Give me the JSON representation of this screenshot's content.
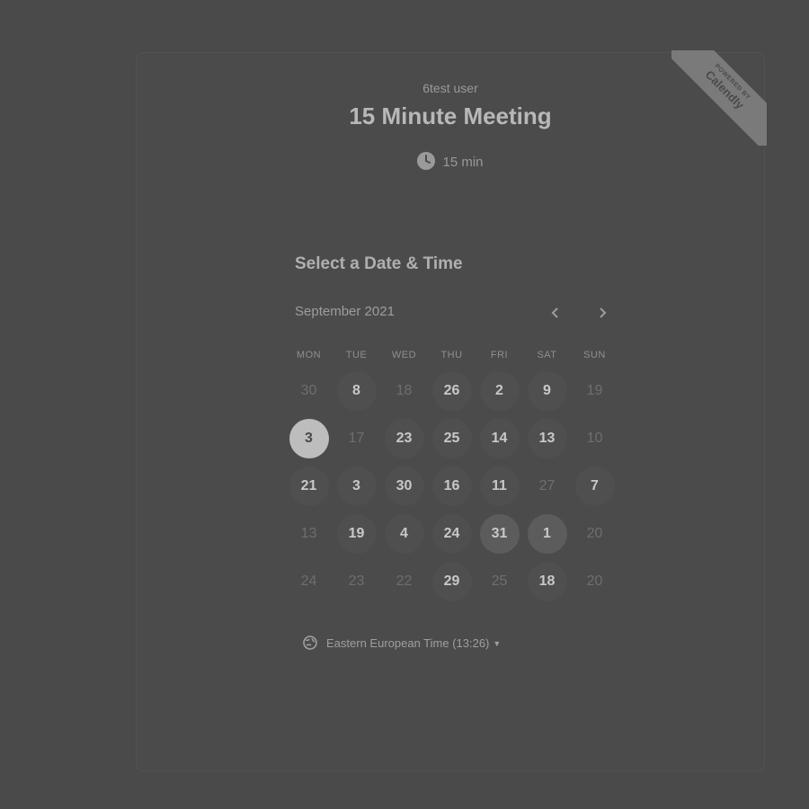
{
  "owner": "6test user",
  "title": "15 Minute Meeting",
  "duration": "15 min",
  "ribbon": {
    "line1": "POWERED BY",
    "line2": "Calendly"
  },
  "heading": "Select a Date & Time",
  "month_label": "September 2021",
  "weekdays": [
    "MON",
    "TUE",
    "WED",
    "THU",
    "FRI",
    "SAT",
    "SUN"
  ],
  "weeks": [
    [
      {
        "n": "30",
        "s": "unavail"
      },
      {
        "n": "8",
        "s": "avail"
      },
      {
        "n": "18",
        "s": "unavail"
      },
      {
        "n": "26",
        "s": "avail"
      },
      {
        "n": "2",
        "s": "avail"
      },
      {
        "n": "9",
        "s": "avail"
      },
      {
        "n": "19",
        "s": "unavail"
      }
    ],
    [
      {
        "n": "3",
        "s": "selected"
      },
      {
        "n": "17",
        "s": "unavail"
      },
      {
        "n": "23",
        "s": "avail"
      },
      {
        "n": "25",
        "s": "avail"
      },
      {
        "n": "14",
        "s": "avail"
      },
      {
        "n": "13",
        "s": "avail"
      },
      {
        "n": "10",
        "s": "unavail"
      }
    ],
    [
      {
        "n": "21",
        "s": "avail"
      },
      {
        "n": "3",
        "s": "avail"
      },
      {
        "n": "30",
        "s": "avail"
      },
      {
        "n": "16",
        "s": "avail"
      },
      {
        "n": "11",
        "s": "avail"
      },
      {
        "n": "27",
        "s": "unavail"
      },
      {
        "n": "7",
        "s": "avail"
      }
    ],
    [
      {
        "n": "13",
        "s": "unavail"
      },
      {
        "n": "19",
        "s": "avail"
      },
      {
        "n": "4",
        "s": "avail"
      },
      {
        "n": "24",
        "s": "avail"
      },
      {
        "n": "31",
        "s": "highlight"
      },
      {
        "n": "1",
        "s": "highlight"
      },
      {
        "n": "20",
        "s": "unavail"
      }
    ],
    [
      {
        "n": "24",
        "s": "unavail"
      },
      {
        "n": "23",
        "s": "unavail"
      },
      {
        "n": "22",
        "s": "unavail"
      },
      {
        "n": "29",
        "s": "avail"
      },
      {
        "n": "25",
        "s": "unavail"
      },
      {
        "n": "18",
        "s": "avail"
      },
      {
        "n": "20",
        "s": "unavail"
      }
    ]
  ],
  "timezone": "Eastern European Time (13:26)",
  "icons": {
    "duration": "clock-icon",
    "timezone": "globe-icon",
    "prev": "chevron-left-icon",
    "next": "chevron-right-icon",
    "tz_caret": "caret-down-icon"
  }
}
